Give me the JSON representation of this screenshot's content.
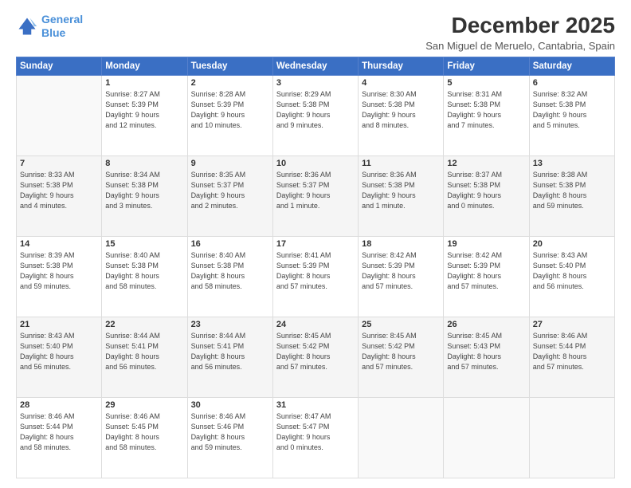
{
  "logo": {
    "line1": "General",
    "line2": "Blue"
  },
  "title": "December 2025",
  "subtitle": "San Miguel de Meruelo, Cantabria, Spain",
  "days_header": [
    "Sunday",
    "Monday",
    "Tuesday",
    "Wednesday",
    "Thursday",
    "Friday",
    "Saturday"
  ],
  "weeks": [
    [
      {
        "num": "",
        "info": ""
      },
      {
        "num": "1",
        "info": "Sunrise: 8:27 AM\nSunset: 5:39 PM\nDaylight: 9 hours\nand 12 minutes."
      },
      {
        "num": "2",
        "info": "Sunrise: 8:28 AM\nSunset: 5:39 PM\nDaylight: 9 hours\nand 10 minutes."
      },
      {
        "num": "3",
        "info": "Sunrise: 8:29 AM\nSunset: 5:38 PM\nDaylight: 9 hours\nand 9 minutes."
      },
      {
        "num": "4",
        "info": "Sunrise: 8:30 AM\nSunset: 5:38 PM\nDaylight: 9 hours\nand 8 minutes."
      },
      {
        "num": "5",
        "info": "Sunrise: 8:31 AM\nSunset: 5:38 PM\nDaylight: 9 hours\nand 7 minutes."
      },
      {
        "num": "6",
        "info": "Sunrise: 8:32 AM\nSunset: 5:38 PM\nDaylight: 9 hours\nand 5 minutes."
      }
    ],
    [
      {
        "num": "7",
        "info": "Sunrise: 8:33 AM\nSunset: 5:38 PM\nDaylight: 9 hours\nand 4 minutes."
      },
      {
        "num": "8",
        "info": "Sunrise: 8:34 AM\nSunset: 5:38 PM\nDaylight: 9 hours\nand 3 minutes."
      },
      {
        "num": "9",
        "info": "Sunrise: 8:35 AM\nSunset: 5:37 PM\nDaylight: 9 hours\nand 2 minutes."
      },
      {
        "num": "10",
        "info": "Sunrise: 8:36 AM\nSunset: 5:37 PM\nDaylight: 9 hours\nand 1 minute."
      },
      {
        "num": "11",
        "info": "Sunrise: 8:36 AM\nSunset: 5:38 PM\nDaylight: 9 hours\nand 1 minute."
      },
      {
        "num": "12",
        "info": "Sunrise: 8:37 AM\nSunset: 5:38 PM\nDaylight: 9 hours\nand 0 minutes."
      },
      {
        "num": "13",
        "info": "Sunrise: 8:38 AM\nSunset: 5:38 PM\nDaylight: 8 hours\nand 59 minutes."
      }
    ],
    [
      {
        "num": "14",
        "info": "Sunrise: 8:39 AM\nSunset: 5:38 PM\nDaylight: 8 hours\nand 59 minutes."
      },
      {
        "num": "15",
        "info": "Sunrise: 8:40 AM\nSunset: 5:38 PM\nDaylight: 8 hours\nand 58 minutes."
      },
      {
        "num": "16",
        "info": "Sunrise: 8:40 AM\nSunset: 5:38 PM\nDaylight: 8 hours\nand 58 minutes."
      },
      {
        "num": "17",
        "info": "Sunrise: 8:41 AM\nSunset: 5:39 PM\nDaylight: 8 hours\nand 57 minutes."
      },
      {
        "num": "18",
        "info": "Sunrise: 8:42 AM\nSunset: 5:39 PM\nDaylight: 8 hours\nand 57 minutes."
      },
      {
        "num": "19",
        "info": "Sunrise: 8:42 AM\nSunset: 5:39 PM\nDaylight: 8 hours\nand 57 minutes."
      },
      {
        "num": "20",
        "info": "Sunrise: 8:43 AM\nSunset: 5:40 PM\nDaylight: 8 hours\nand 56 minutes."
      }
    ],
    [
      {
        "num": "21",
        "info": "Sunrise: 8:43 AM\nSunset: 5:40 PM\nDaylight: 8 hours\nand 56 minutes."
      },
      {
        "num": "22",
        "info": "Sunrise: 8:44 AM\nSunset: 5:41 PM\nDaylight: 8 hours\nand 56 minutes."
      },
      {
        "num": "23",
        "info": "Sunrise: 8:44 AM\nSunset: 5:41 PM\nDaylight: 8 hours\nand 56 minutes."
      },
      {
        "num": "24",
        "info": "Sunrise: 8:45 AM\nSunset: 5:42 PM\nDaylight: 8 hours\nand 57 minutes."
      },
      {
        "num": "25",
        "info": "Sunrise: 8:45 AM\nSunset: 5:42 PM\nDaylight: 8 hours\nand 57 minutes."
      },
      {
        "num": "26",
        "info": "Sunrise: 8:45 AM\nSunset: 5:43 PM\nDaylight: 8 hours\nand 57 minutes."
      },
      {
        "num": "27",
        "info": "Sunrise: 8:46 AM\nSunset: 5:44 PM\nDaylight: 8 hours\nand 57 minutes."
      }
    ],
    [
      {
        "num": "28",
        "info": "Sunrise: 8:46 AM\nSunset: 5:44 PM\nDaylight: 8 hours\nand 58 minutes."
      },
      {
        "num": "29",
        "info": "Sunrise: 8:46 AM\nSunset: 5:45 PM\nDaylight: 8 hours\nand 58 minutes."
      },
      {
        "num": "30",
        "info": "Sunrise: 8:46 AM\nSunset: 5:46 PM\nDaylight: 8 hours\nand 59 minutes."
      },
      {
        "num": "31",
        "info": "Sunrise: 8:47 AM\nSunset: 5:47 PM\nDaylight: 9 hours\nand 0 minutes."
      },
      {
        "num": "",
        "info": ""
      },
      {
        "num": "",
        "info": ""
      },
      {
        "num": "",
        "info": ""
      }
    ]
  ]
}
